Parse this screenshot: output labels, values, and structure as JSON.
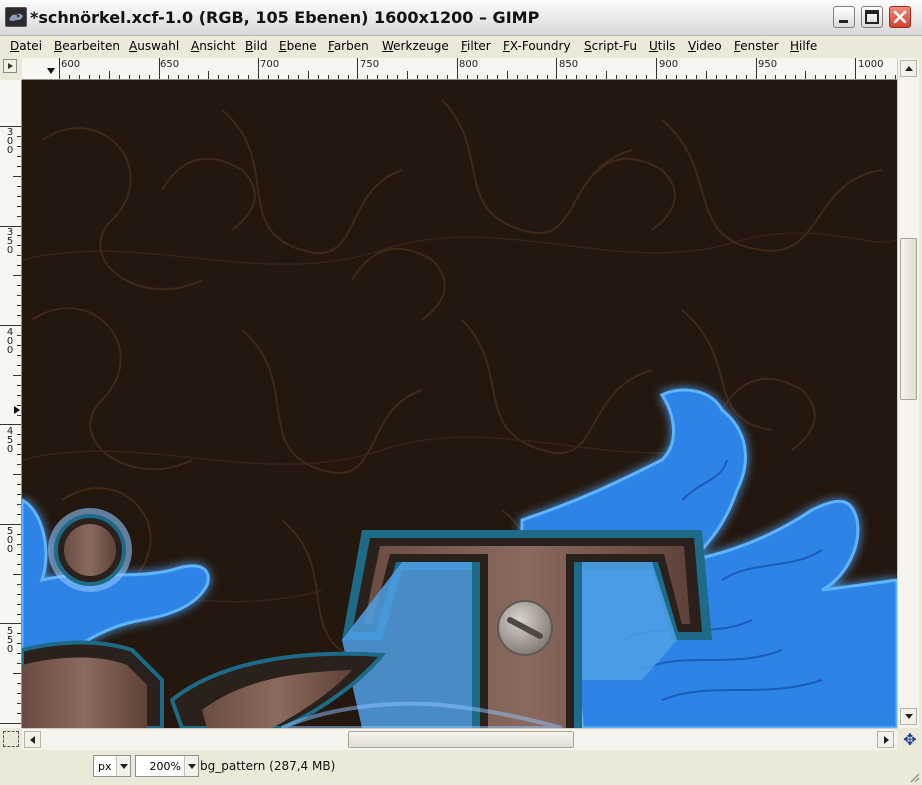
{
  "window": {
    "title": "*schnörkel.xcf-1.0 (RGB, 105 Ebenen) 1600x1200 – GIMP",
    "icon": "gimp-wilber-icon"
  },
  "menu": {
    "items": [
      "Datei",
      "Bearbeiten",
      "Auswahl",
      "Ansicht",
      "Bild",
      "Ebene",
      "Farben",
      "Werkzeuge",
      "Filter",
      "FX-Foundry",
      "Script-Fu",
      "Utils",
      "Video",
      "Fenster",
      "Hilfe"
    ]
  },
  "ruler": {
    "horizontal_labels": [
      "600",
      "650",
      "700",
      "750",
      "800",
      "850",
      "900",
      "950",
      "1000"
    ],
    "vertical_labels": [
      "300",
      "350",
      "400",
      "450",
      "500",
      "550"
    ]
  },
  "status": {
    "unit": "px",
    "zoom": "200%",
    "layer_info": "bg_pattern (287,4 MB)"
  },
  "colors": {
    "canvas_background": "#23170e",
    "glow_blue": "#2f8cf5",
    "wood_brown": "#6e4f44",
    "teal_outline": "#1d6b86"
  }
}
